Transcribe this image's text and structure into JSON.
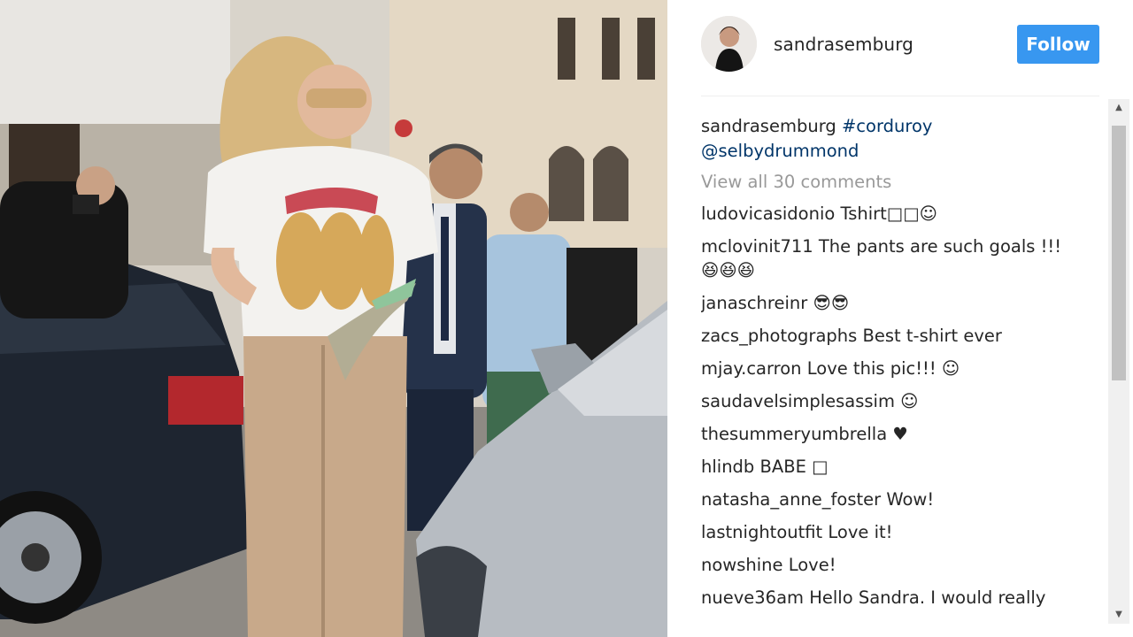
{
  "post": {
    "author": "sandrasemburg",
    "follow_label": "Follow",
    "caption_author": "sandrasemburg",
    "caption_hashtag": "#corduroy",
    "caption_mention": "@selbydrummond",
    "view_all_comments": "View all 30 comments"
  },
  "comments": [
    {
      "user": "ludovicasidonio",
      "text": "Tshirt□□☺"
    },
    {
      "user": "mclovinit711",
      "text": "The pants are such goals !!! 😆😆😆"
    },
    {
      "user": "janaschreinr",
      "text": "😎😎"
    },
    {
      "user": "zacs_photographs",
      "text": "Best t-shirt ever"
    },
    {
      "user": "mjay.carron",
      "text": "Love this pic!!! ☺"
    },
    {
      "user": "saudavelsimplesassim",
      "text": "☺"
    },
    {
      "user": "thesummeryumbrella",
      "text": "♥"
    },
    {
      "user": "hlindb",
      "text": "BABE □"
    },
    {
      "user": "natasha_anne_foster",
      "text": "Wow!"
    },
    {
      "user": "lastnightoutfit",
      "text": "Love it!"
    },
    {
      "user": "nowshine",
      "text": "Love!"
    },
    {
      "user": "nueve36am",
      "text": "Hello Sandra. I would really"
    }
  ],
  "colors": {
    "follow_button": "#3897f0",
    "link": "#003569",
    "muted": "#999999",
    "text": "#262626"
  },
  "icons": {
    "scroll_up": "triangle-up-icon",
    "scroll_down": "triangle-down-icon"
  }
}
